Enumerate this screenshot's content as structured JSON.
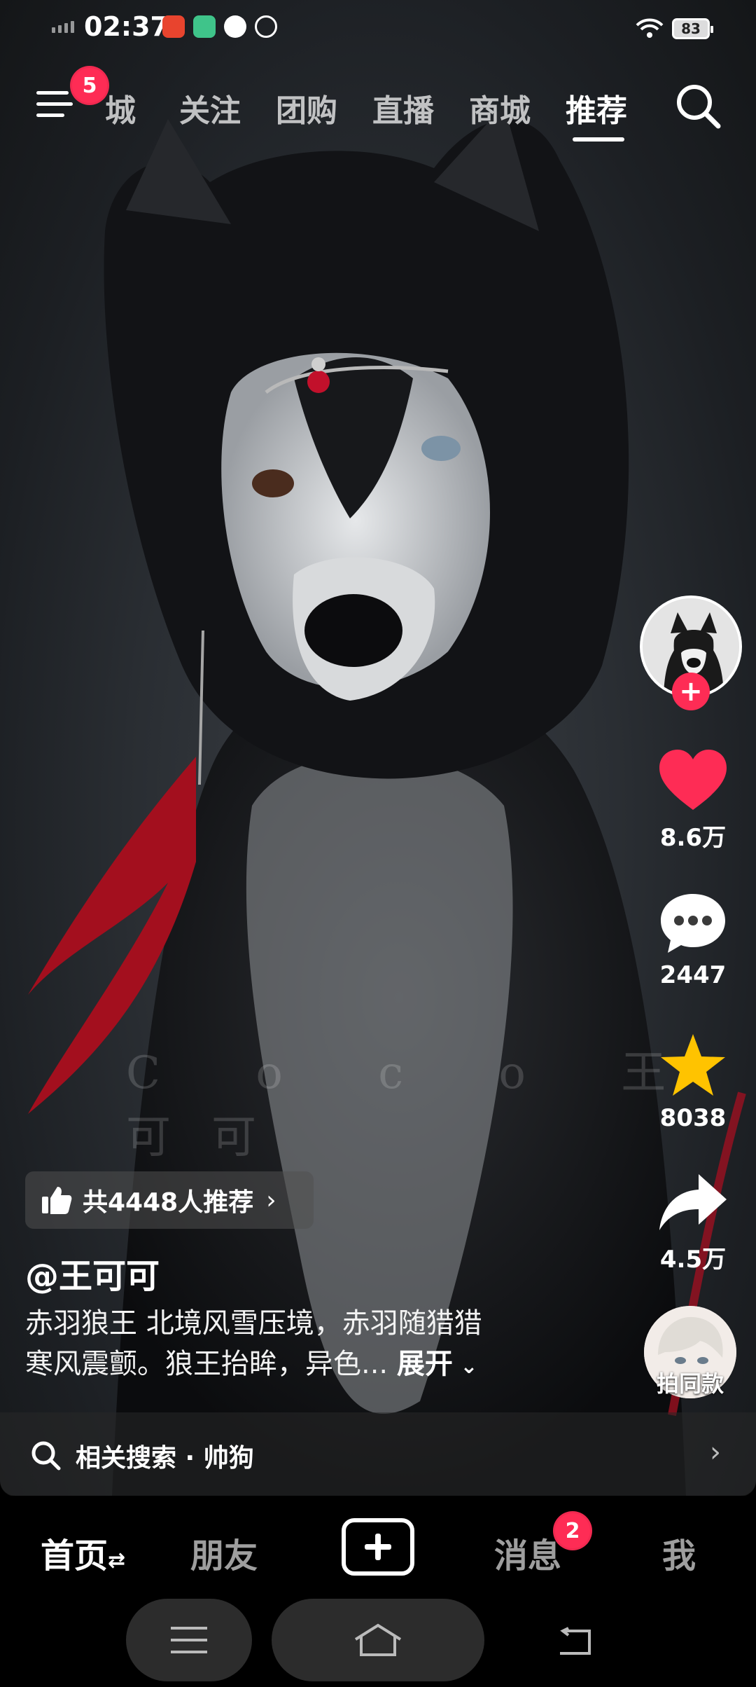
{
  "status_bar": {
    "time": "02:37",
    "battery": "83"
  },
  "top_nav": {
    "menu_badge": "5",
    "tabs": [
      {
        "label": "城",
        "active": false
      },
      {
        "label": "关注",
        "active": false
      },
      {
        "label": "团购",
        "active": false
      },
      {
        "label": "直播",
        "active": false
      },
      {
        "label": "商城",
        "active": false
      },
      {
        "label": "推荐",
        "active": true
      }
    ]
  },
  "video": {
    "watermark": "C o c o  王可可"
  },
  "side_rail": {
    "likes": "8.6万",
    "comments": "2447",
    "favorites": "8038",
    "shares": "4.5万",
    "same_style_label": "拍同款"
  },
  "post": {
    "recommend_text": "共4448人推荐",
    "author": "@王可可",
    "desc_line1": "赤羽狼王 北境风雪压境，赤羽随猎猎",
    "desc_line2": "寒风震颤。狼王抬眸，异色...",
    "expand_label": "展开"
  },
  "related_search": {
    "label": "相关搜索 · 帅狗"
  },
  "bottom_nav": {
    "home": "首页",
    "friends": "朋友",
    "messages": "消息",
    "messages_badge": "2",
    "me": "我"
  },
  "colors": {
    "accent": "#fe2c55",
    "like": "#fe2c55",
    "favorite": "#ffc300"
  }
}
